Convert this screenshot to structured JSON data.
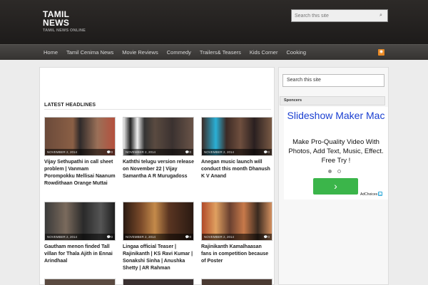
{
  "header": {
    "logo_line1": "TAMIL",
    "logo_line2": "NEWS",
    "tagline": "TAMIL NEWS ONLINE",
    "search_placeholder": "Search this site"
  },
  "nav": {
    "items": [
      "Home",
      "Tamil Cenima News",
      "Movie Reviews",
      "Commedy",
      "Trailers& Teasers",
      "Kids Corner",
      "Cooking"
    ]
  },
  "main": {
    "section_title": "LATEST HEADLINES",
    "posts": [
      {
        "title": "Vijay Sethupathi in call sheet problem | Vanmam Porompokku Mellisai Naanum Rowdithaan Orange Muttai",
        "date": "NOVEMBER 2, 2014",
        "comments": "0"
      },
      {
        "title": "Kaththi telugu version release on November 22 | Vijay Samantha A R Murugadoss",
        "date": "NOVEMBER 2, 2014",
        "comments": "0"
      },
      {
        "title": "Anegan music launch will conduct this month Dhanush K V Anand",
        "date": "NOVEMBER 2, 2014",
        "comments": "0"
      },
      {
        "title": "Gautham menon finded Tall villan for Thala Ajith in Ennai Arindhaal",
        "date": "NOVEMBER 2, 2014",
        "comments": "0"
      },
      {
        "title": "Lingaa official Teaser | Rajinikanth | KS Ravi Kumar | Sonakshi Sinha | Anushka Shetty | AR Rahman",
        "date": "NOVEMBER 2, 2014",
        "comments": "0"
      },
      {
        "title": "Rajinikanth Kamalhaasan fans in competition because of Poster",
        "date": "NOVEMBER 2, 2014",
        "comments": "0"
      }
    ]
  },
  "sidebar": {
    "search_placeholder": "Search this site",
    "sponsors_label": "Sponcers"
  },
  "ad": {
    "title": "Slideshow Maker Mac",
    "body": "Make Pro-Quality Video With Photos, Add Text, Music, Effect. Free Try !",
    "button": "›",
    "adchoices": "AdChoices"
  },
  "colors": {
    "header_bg": "#232120",
    "nav_bg": "#403e3c",
    "ad_title": "#1a3fd1",
    "ad_button": "#3bb54a"
  }
}
